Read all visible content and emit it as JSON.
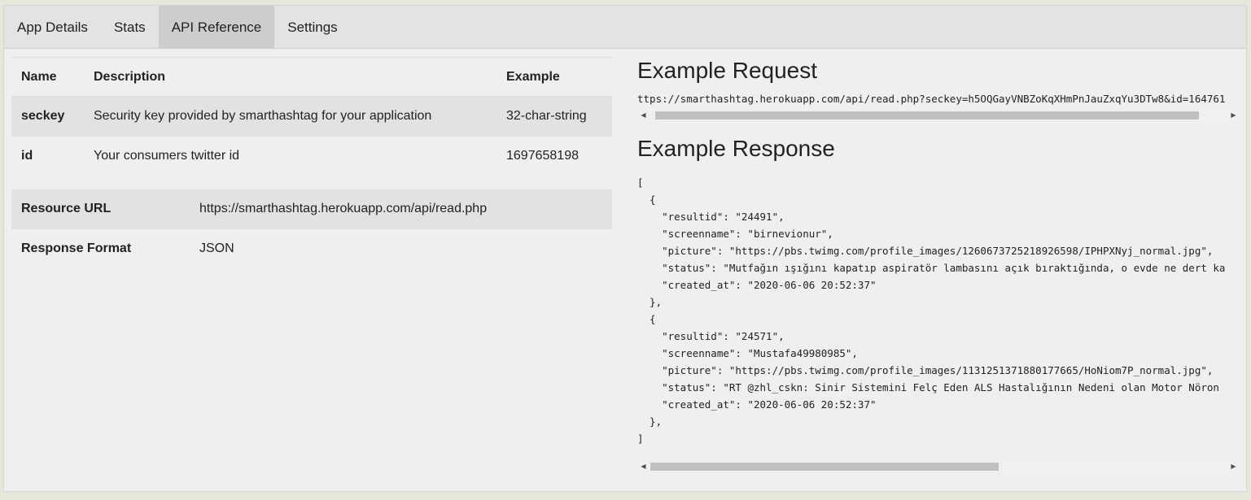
{
  "tabs": [
    {
      "label": "App Details"
    },
    {
      "label": "Stats"
    },
    {
      "label": "API Reference"
    },
    {
      "label": "Settings"
    }
  ],
  "params": {
    "headers": [
      "Name",
      "Description",
      "Example"
    ],
    "rows": [
      {
        "name": "seckey",
        "description": "Security key provided by smarthashtag for your application",
        "example": "32-char-string"
      },
      {
        "name": "id",
        "description": "Your consumers twitter id",
        "example": "1697658198"
      }
    ]
  },
  "resource": {
    "url_label": "Resource URL",
    "url_value": "https://smarthashtag.herokuapp.com/api/read.php",
    "format_label": "Response Format",
    "format_value": "JSON"
  },
  "request": {
    "title": "Example Request",
    "url": "ttps://smarthashtag.herokuapp.com/api/read.php?seckey=h5OQGayVNBZoKqXHmPnJauZxqYu3DTw8&id=164761"
  },
  "response": {
    "title": "Example Response",
    "lines": [
      "[",
      "  {",
      "    \"resultid\": \"24491\",",
      "    \"screenname\": \"birnevionur\",",
      "    \"picture\": \"https://pbs.twimg.com/profile_images/1260673725218926598/IPHPXNyj_normal.jpg\",",
      "    \"status\": \"Mutfağın ışığını kapatıp aspiratör lambasını açık bıraktığında, o evde ne dert ka",
      "    \"created_at\": \"2020-06-06 20:52:37\"",
      "  },",
      "  {",
      "    \"resultid\": \"24571\",",
      "    \"screenname\": \"Mustafa49980985\",",
      "    \"picture\": \"https://pbs.twimg.com/profile_images/1131251371880177665/HoNiom7P_normal.jpg\",",
      "    \"status\": \"RT @zhl_cskn: Sinir Sistemini Felç Eden ALS Hastalığının Nedeni olan Motor Nöron",
      "    \"created_at\": \"2020-06-06 20:52:37\"",
      "  },",
      "]"
    ]
  },
  "icons": {
    "scroll_left": "◀",
    "scroll_right": "▶"
  }
}
